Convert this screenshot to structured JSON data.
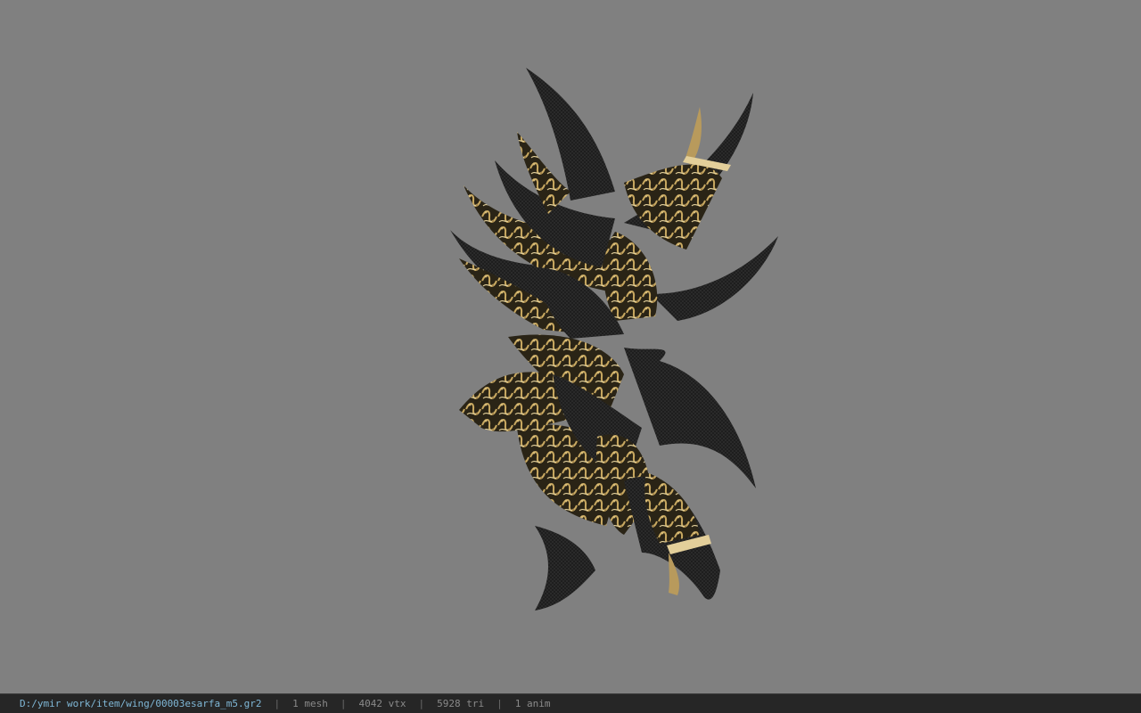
{
  "statusbar": {
    "file_path": "D:/ymir work/item/wing/00003esarfa_m5.gr2",
    "mesh_count": "1 mesh",
    "vertex_count": "4042 vtx",
    "triangle_count": "5928 tri",
    "anim_count": "1 anim"
  },
  "viewport": {
    "background_color": "#808080",
    "model_colors": {
      "dark": "#1b1b1b",
      "gold": "#b89a5c",
      "gold_light": "#e3cf9a"
    }
  }
}
